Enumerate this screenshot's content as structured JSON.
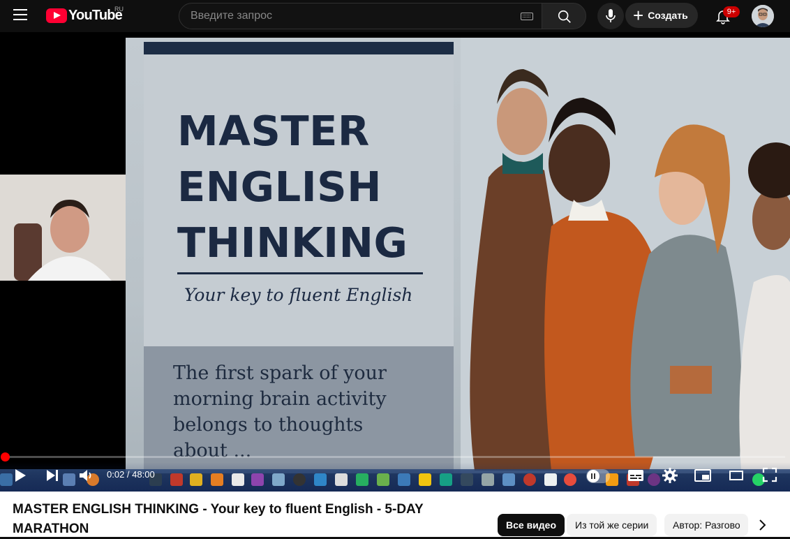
{
  "header": {
    "logo_text": "YouTube",
    "region": "RU",
    "search_placeholder": "Введите запрос",
    "create_label": "Создать",
    "notification_count": "9+"
  },
  "slide": {
    "title_lines": [
      "MASTER",
      "ENGLISH",
      "THINKING"
    ],
    "subtitle": "Your key to fluent English",
    "body_lines": [
      "The first spark of your",
      "morning brain activity",
      "belongs to thoughts",
      "about ..."
    ]
  },
  "player": {
    "current_time": "0:02",
    "duration": "48:00",
    "time_display": "0:02 / 48:00",
    "progress": 0.0007
  },
  "video": {
    "title": "MASTER ENGLISH THINKING - Your key to fluent English - 5-DAY MARATHON"
  },
  "chips": [
    "Все видео",
    "Из той же серии",
    "Автор: Разгово"
  ],
  "colors": {
    "brand_red": "#ff0033",
    "progress_red": "#ff0000",
    "header_bg": "#0f0f0f",
    "slide_navy": "#1b2942"
  }
}
